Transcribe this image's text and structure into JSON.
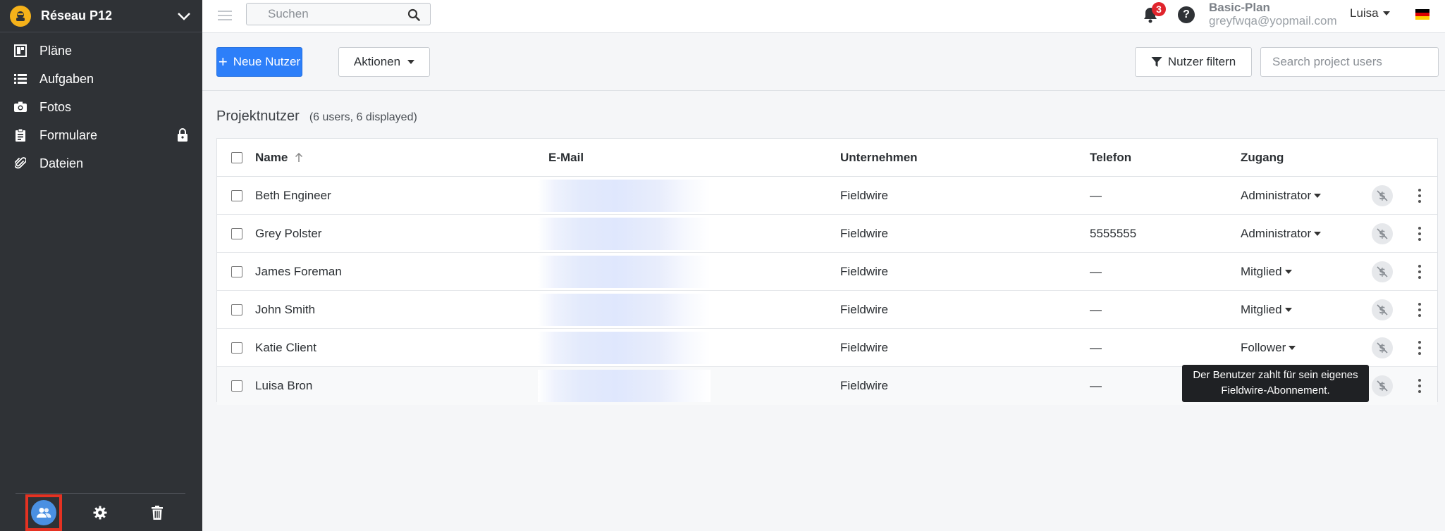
{
  "sidebar": {
    "project_name": "Réseau P12",
    "items": [
      {
        "label": "Pläne",
        "icon": "plans-icon"
      },
      {
        "label": "Aufgaben",
        "icon": "list-icon"
      },
      {
        "label": "Fotos",
        "icon": "camera-icon"
      },
      {
        "label": "Formulare",
        "icon": "clipboard-icon",
        "locked": true
      },
      {
        "label": "Dateien",
        "icon": "paperclip-icon"
      }
    ],
    "footer": [
      "users-icon",
      "gear-icon",
      "trash-icon"
    ]
  },
  "topbar": {
    "search_placeholder": "Suchen",
    "notification_count": "3",
    "help_label": "?",
    "plan_name": "Basic-Plan",
    "plan_email": "greyfwqa@yopmail.com",
    "user_name": "Luisa"
  },
  "toolbar": {
    "new_user_label": "Neue Nutzer",
    "actions_label": "Aktionen",
    "filter_label": "Nutzer filtern",
    "search_placeholder": "Search project users"
  },
  "section": {
    "title": "Projektnutzer",
    "count": "(6 users, 6 displayed)"
  },
  "table": {
    "headers": {
      "name": "Name",
      "email": "E-Mail",
      "company": "Unternehmen",
      "phone": "Telefon",
      "access": "Zugang"
    },
    "rows": [
      {
        "name": "Beth Engineer",
        "company": "Fieldwire",
        "phone": "—",
        "access": "Administrator"
      },
      {
        "name": "Grey Polster",
        "company": "Fieldwire",
        "phone": "5555555",
        "access": "Administrator"
      },
      {
        "name": "James Foreman",
        "company": "Fieldwire",
        "phone": "—",
        "access": "Mitglied"
      },
      {
        "name": "John Smith",
        "company": "Fieldwire",
        "phone": "—",
        "access": "Mitglied"
      },
      {
        "name": "Katie Client",
        "company": "Fieldwire",
        "phone": "—",
        "access": "Follower"
      },
      {
        "name": "Luisa Bron",
        "company": "Fieldwire",
        "phone": "—",
        "access": ""
      }
    ]
  },
  "tooltip": {
    "line1": "Der Benutzer zahlt für sein eigenes",
    "line2": "Fieldwire-Abonnement."
  },
  "colors": {
    "sidebar_bg": "#2f3236",
    "primary": "#2d7ff9",
    "badge": "#e0242c",
    "highlight": "#e53222"
  }
}
